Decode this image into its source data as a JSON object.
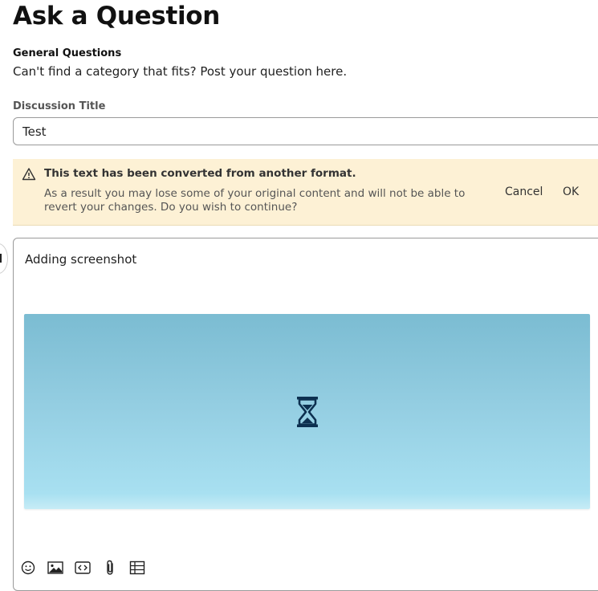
{
  "page": {
    "title": "Ask a Question"
  },
  "category": {
    "name": "General Questions",
    "description": "Can't find a category that fits? Post your question here."
  },
  "discussion_title": {
    "label": "Discussion Title",
    "value": "Test"
  },
  "warning": {
    "title": "This text has been converted from another format.",
    "body": "As a result you may lose some of your original content and will not be able to revert your changes. Do you wish to continue?",
    "cancel_label": "Cancel",
    "ok_label": "OK",
    "icon": "warning-triangle-icon"
  },
  "editor": {
    "text": "Adding screenshot",
    "image_state_icon": "hourglass-icon",
    "toolbar_icons": [
      "emoji-icon",
      "image-icon",
      "code-icon",
      "attachment-icon",
      "table-icon"
    ]
  },
  "colors": {
    "warning_bg": "#fdf1d5",
    "image_placeholder_top": "#7bbcd2",
    "image_placeholder_bottom": "#c7ecf6",
    "hourglass": "#0d3050"
  }
}
